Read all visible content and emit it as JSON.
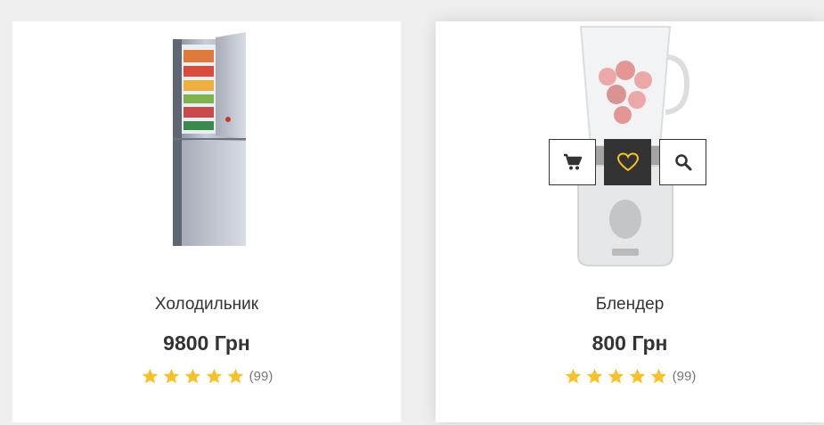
{
  "products": [
    {
      "title": "Холодильник",
      "price": "9800 Грн",
      "rating_stars": 5,
      "review_count": "(99)",
      "image_icon": "refrigerator-image"
    },
    {
      "title": "Блендер",
      "price": "800 Грн",
      "rating_stars": 5,
      "review_count": "(99)",
      "image_icon": "blender-image",
      "hover_actions": [
        "cart-icon",
        "heart-icon",
        "search-icon"
      ]
    }
  ],
  "colors": {
    "star": "#f8c12a",
    "dark_button": "#333333",
    "heart": "#f8c12a",
    "text": "#333333"
  }
}
